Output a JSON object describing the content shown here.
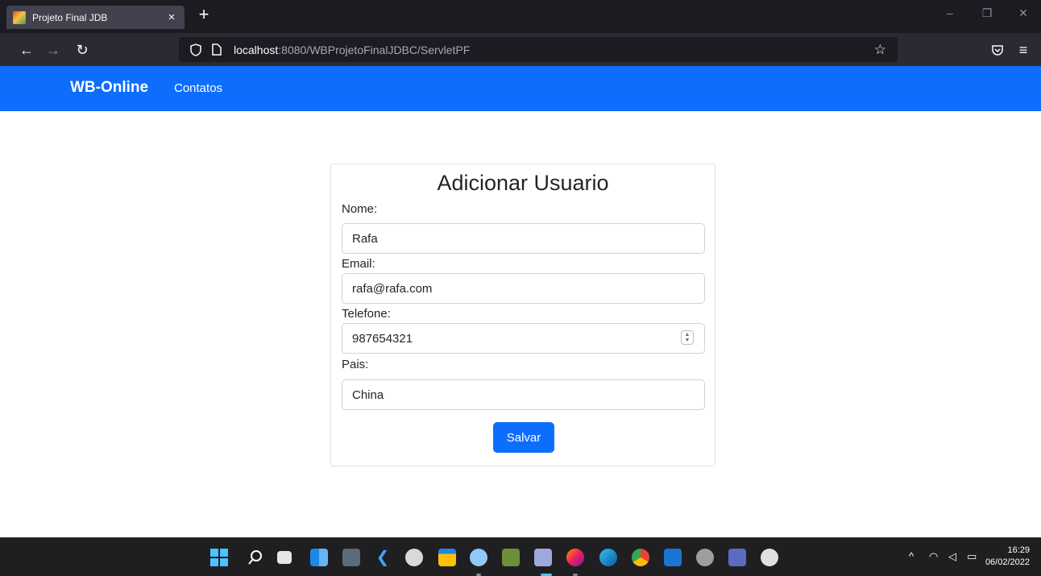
{
  "browser": {
    "tab_title": "Projeto Final JDB",
    "tab_close": "×",
    "new_tab": "+",
    "url_host": "localhost",
    "url_rest": ":8080/WBProjetoFinalJDBC/ServletPF",
    "back_icon": "arrow-left-icon",
    "forward_icon": "arrow-right-icon",
    "reload_icon": "reload-icon"
  },
  "site": {
    "brand": "WB-Online",
    "nav_link": "Contatos",
    "colors": {
      "navbar": "#0d6efd",
      "button": "#0d6efd"
    }
  },
  "form": {
    "title": "Adicionar Usuario",
    "fields": [
      {
        "label": "Nome:",
        "value": "Rafa"
      },
      {
        "label": "Email:",
        "value": "rafa@rafa.com"
      },
      {
        "label": "Telefone:",
        "value": "987654321"
      },
      {
        "label": "Pais:",
        "value": "China"
      }
    ],
    "submit_label": "Salvar"
  },
  "taskbar": {
    "apps": [
      "windows-start-icon",
      "search-icon",
      "task-view-icon",
      "widgets-icon",
      "mysql-workbench-icon",
      "vscode-icon",
      "app-icon",
      "file-explorer-icon",
      "notepad-icon",
      "image-editor-icon",
      "app-icon-2",
      "firefox-icon",
      "edge-icon",
      "chrome-icon",
      "mail-icon",
      "settings-icon",
      "app-icon-3",
      "app-icon-4"
    ],
    "time": "16:29",
    "date": "06/02/2022"
  }
}
